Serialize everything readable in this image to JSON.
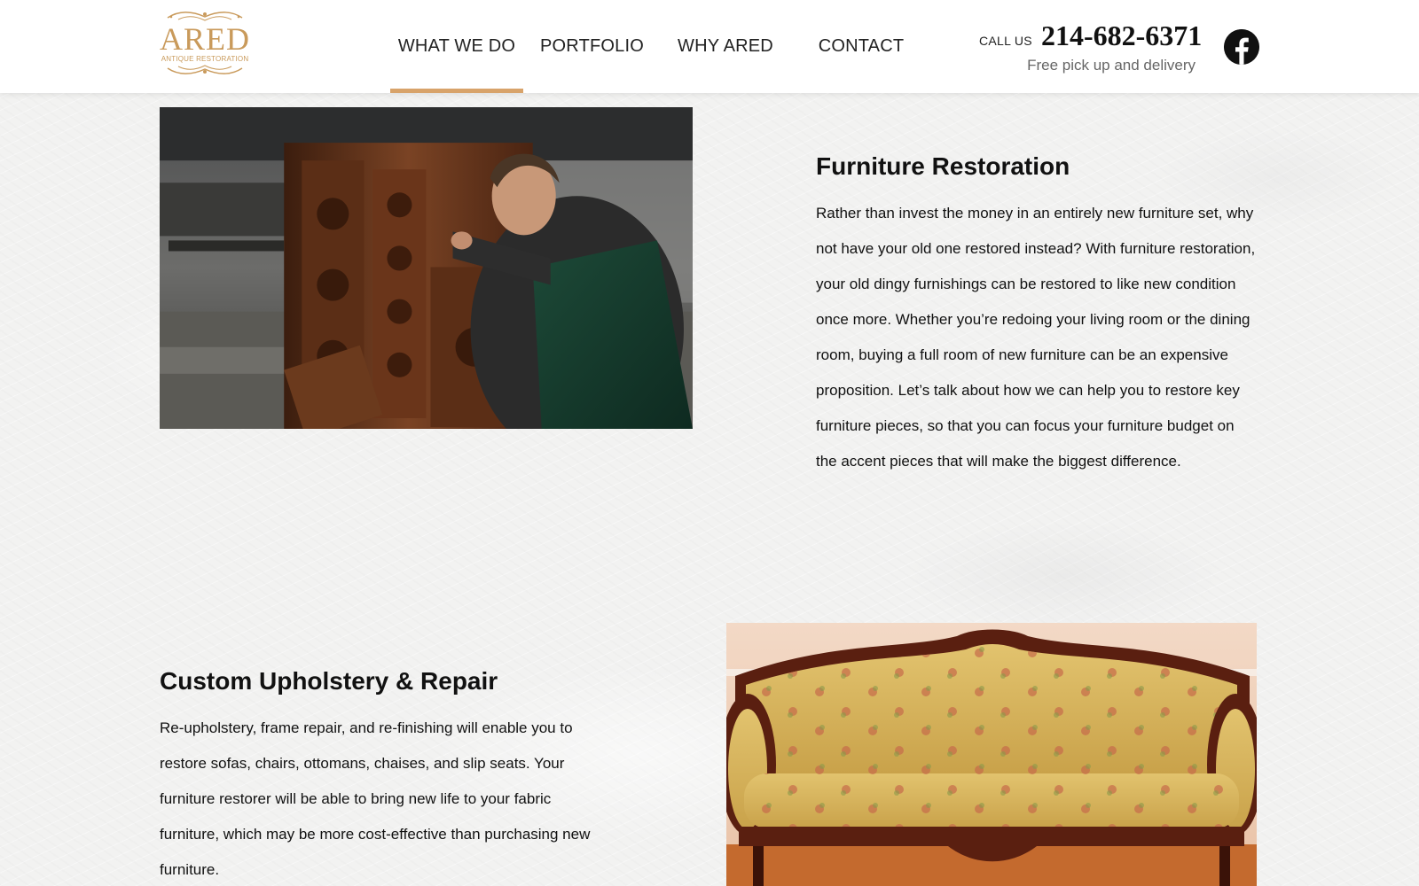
{
  "brand": {
    "logo_text": "ARED",
    "logo_subtext": "ANTIQUE RESTORATION",
    "accent_color": "#d8a36a"
  },
  "nav": {
    "items": [
      {
        "label": "WHAT WE DO",
        "active": true
      },
      {
        "label": "PORTFOLIO",
        "active": false
      },
      {
        "label": "WHY ARED",
        "active": false
      },
      {
        "label": "CONTACT",
        "active": false
      }
    ]
  },
  "contact": {
    "call_label": "CALL US",
    "phone": "214-682-6371",
    "tagline": "Free pick up and delivery"
  },
  "social": {
    "facebook_icon": "facebook-icon"
  },
  "sections": [
    {
      "title": "Furniture Restoration",
      "body": "Rather than invest the money in an entirely new furniture set, why not have your old one restored instead? With furniture restoration, your old dingy furnishings can be restored to like new condition once more. Whether you’re redoing your living room or the dining room, buying a full room of new furniture can be an expensive proposition. Let’s talk about how we can help you to restore key furniture pieces, so that you can focus your furniture budget on the accent pieces that will make the biggest difference."
    },
    {
      "title": "Custom Upholstery & Repair",
      "body": "Re-upholstery, frame repair, and re-finishing will enable you to restore sofas, chairs, ottomans, chaises, and slip seats. Your furniture restorer will be able to bring new life to your fabric furniture, which may be more cost-effective than purchasing new furniture."
    }
  ]
}
